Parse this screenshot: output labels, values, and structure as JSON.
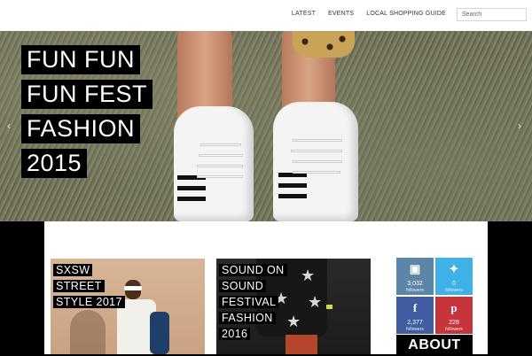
{
  "nav": {
    "items": [
      {
        "label": "LATEST"
      },
      {
        "label": "EVENTS"
      },
      {
        "label": "LOCAL SHOPPING GUIDE"
      }
    ],
    "search_placeholder": "Search"
  },
  "hero": {
    "title_lines": [
      "FUN FUN",
      "FUN FEST",
      "FASHION",
      "2015"
    ],
    "prev_icon": "chevron-left-icon",
    "next_icon": "chevron-right-icon"
  },
  "cards": [
    {
      "title_lines": [
        "SXSW",
        "STREET",
        "STYLE 2017"
      ]
    },
    {
      "title_lines": [
        "SOUND ON",
        "SOUND",
        "FESTIVAL",
        "FASHION",
        "2016"
      ]
    }
  ],
  "social": {
    "instagram": {
      "icon": "instagram-icon",
      "count": "3,032",
      "label": "followers",
      "color": "#5b86a8"
    },
    "twitter": {
      "icon": "twitter-icon",
      "count": "0",
      "label": "followers",
      "color": "#3fb1e6"
    },
    "facebook": {
      "icon": "facebook-icon",
      "count": "2,377",
      "label": "followers",
      "color": "#3f5da0"
    },
    "pinterest": {
      "icon": "pinterest-icon",
      "count": "228",
      "label": "followers",
      "color": "#c6353b"
    }
  },
  "about": {
    "label": "ABOUT"
  }
}
